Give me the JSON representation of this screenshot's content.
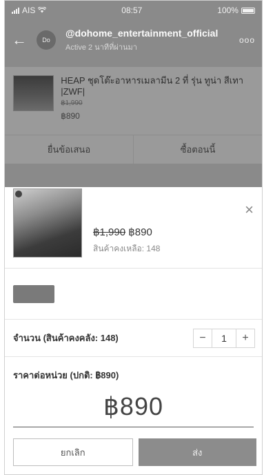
{
  "status_bar": {
    "carrier": "AIS",
    "time": "08:57",
    "battery": "100%"
  },
  "chat_header": {
    "back_icon": "back-arrow-icon",
    "avatar_text": "Do",
    "shop_name": "@dohome_entertainment_official",
    "active_text": "Active 2 นาทีที่ผ่านมา",
    "more_icon": "ooo"
  },
  "product_card": {
    "title": "HEAP ชุดโต๊ะอาหารเมลามีน 2 ที่ รุ่น ทูน่า สีเทา |ZWF|",
    "original_price": "฿1,990",
    "price": "฿890"
  },
  "card_actions": {
    "offer_label": "ยื่นข้อเสนอ",
    "buy_label": "ซื้อตอนนี้"
  },
  "sheet": {
    "old_price": "฿1,990",
    "new_price": "฿890",
    "stock_text": "สินค้าคงเหลือ: 148",
    "close_icon": "×"
  },
  "quantity": {
    "label": "จำนวน (สินค้าคงคลัง: 148)",
    "minus": "−",
    "value": "1",
    "plus": "+"
  },
  "unit_price": {
    "label": "ราคาต่อหน่วย (ปกติ: ฿890)",
    "value": "฿890"
  },
  "footer": {
    "cancel_label": "ยกเลิก",
    "send_label": "ส่ง"
  }
}
